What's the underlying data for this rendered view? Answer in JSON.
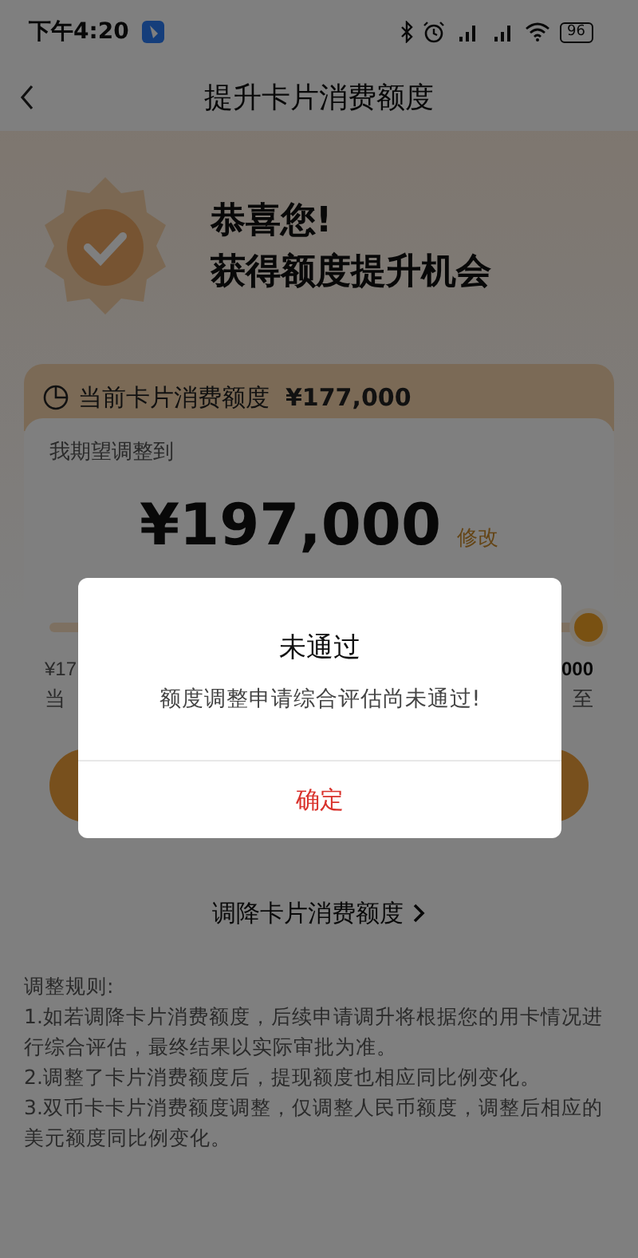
{
  "status_bar": {
    "time": "下午4:20",
    "battery": "96"
  },
  "nav": {
    "title": "提升卡片消费额度"
  },
  "hero": {
    "line_1": "恭喜您!",
    "line_2": "获得额度提升机会"
  },
  "current_limit": {
    "label": "当前卡片消费额度",
    "value": "¥177,000"
  },
  "adjust_card": {
    "label": "我期望调整到",
    "amount": "¥197,000",
    "edit_link": "修改",
    "slider": {
      "level": 1
    },
    "left_value": "¥17",
    "left_caption": "当",
    "right_value": "000",
    "right_caption": "至"
  },
  "decrease_link": "调降卡片消费额度",
  "rules": {
    "title": "调整规则:",
    "items": [
      "1.如若调降卡片消费额度，后续申请调升将根据您的用卡情况进行综合评估，最终结果以实际审批为准。",
      "2.调整了卡片消费额度后，提现额度也相应同比例变化。",
      "3.双币卡卡片消费额度调整，仅调整人民币额度，调整后相应的美元额度同比例变化。"
    ]
  },
  "dialog": {
    "title": "未通过",
    "message": "额度调整申请综合评估尚未通过!",
    "confirm": "确定"
  }
}
